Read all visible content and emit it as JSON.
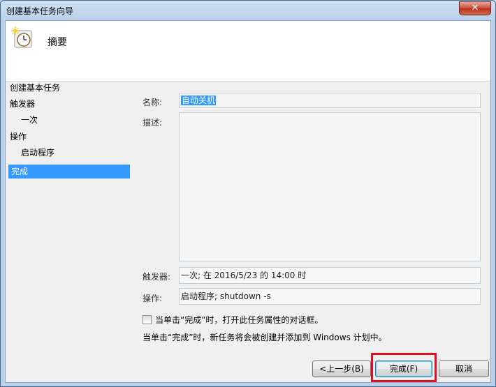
{
  "window": {
    "title": "创建基本任务向导",
    "close_symbol": "✕"
  },
  "header": {
    "icon": "task-clock-icon",
    "title": "摘要"
  },
  "nav": {
    "items": [
      {
        "label": "创建基本任务",
        "selected": false
      },
      {
        "label": "触发器",
        "selected": false
      },
      {
        "label": "一次",
        "selected": false
      },
      {
        "label": "操作",
        "selected": false
      },
      {
        "label": "启动程序",
        "selected": false
      },
      {
        "label": "完成",
        "selected": true
      }
    ]
  },
  "form": {
    "name_label": "名称:",
    "name_value": "自动关机",
    "description_label": "描述:",
    "description_value": "",
    "trigger_label": "触发器:",
    "trigger_value": "一次; 在 2016/5/23 的 14:00 时",
    "action_label": "操作:",
    "action_value": "启动程序; shutdown -s",
    "checkbox_label": "当单击“完成”时，打开此任务属性的对话框。",
    "checkbox_checked": false,
    "info_text": "当单击“完成”时，新任务将会被创建并添加到 Windows 计划中。"
  },
  "buttons": {
    "back": "<上一步(B)",
    "finish": "完成(F)",
    "cancel": "取消"
  },
  "colors": {
    "selection": "#3399ff",
    "highlight_box": "#e01020"
  }
}
